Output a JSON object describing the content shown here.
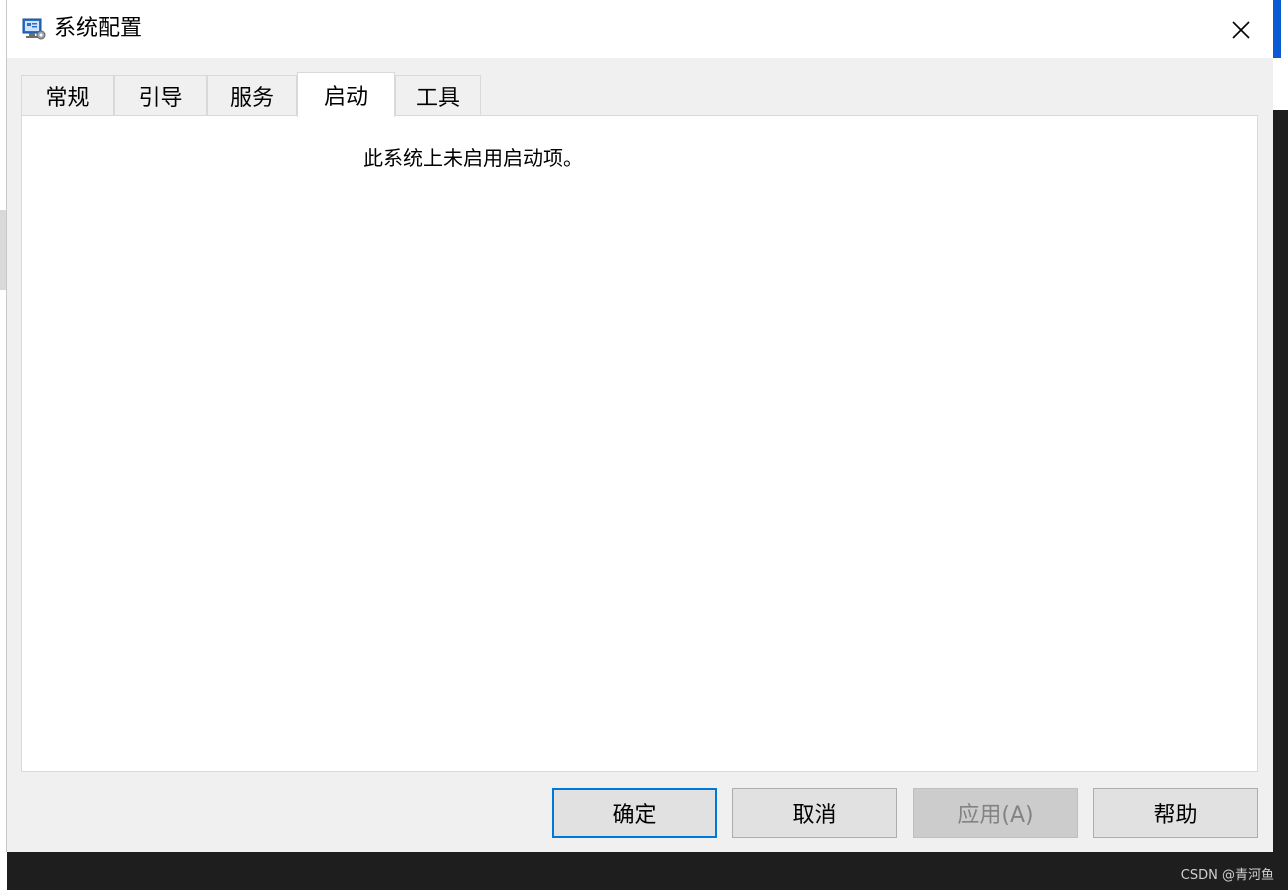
{
  "window": {
    "title": "系统配置",
    "icon": "msconfig-app-icon",
    "close_icon": "close-icon"
  },
  "tabs": [
    {
      "label": "常规",
      "active": false
    },
    {
      "label": "引导",
      "active": false
    },
    {
      "label": "服务",
      "active": false
    },
    {
      "label": "启动",
      "active": true
    },
    {
      "label": "工具",
      "active": false
    }
  ],
  "panel": {
    "message": "此系统上未启用启动项。"
  },
  "buttons": {
    "ok": "确定",
    "cancel": "取消",
    "apply": "应用(A)",
    "help": "帮助"
  },
  "watermark": "CSDN @青河鱼",
  "colors": {
    "accent": "#0078d7",
    "dialog_bg": "#f0f0f0",
    "panel_bg": "#ffffff"
  }
}
